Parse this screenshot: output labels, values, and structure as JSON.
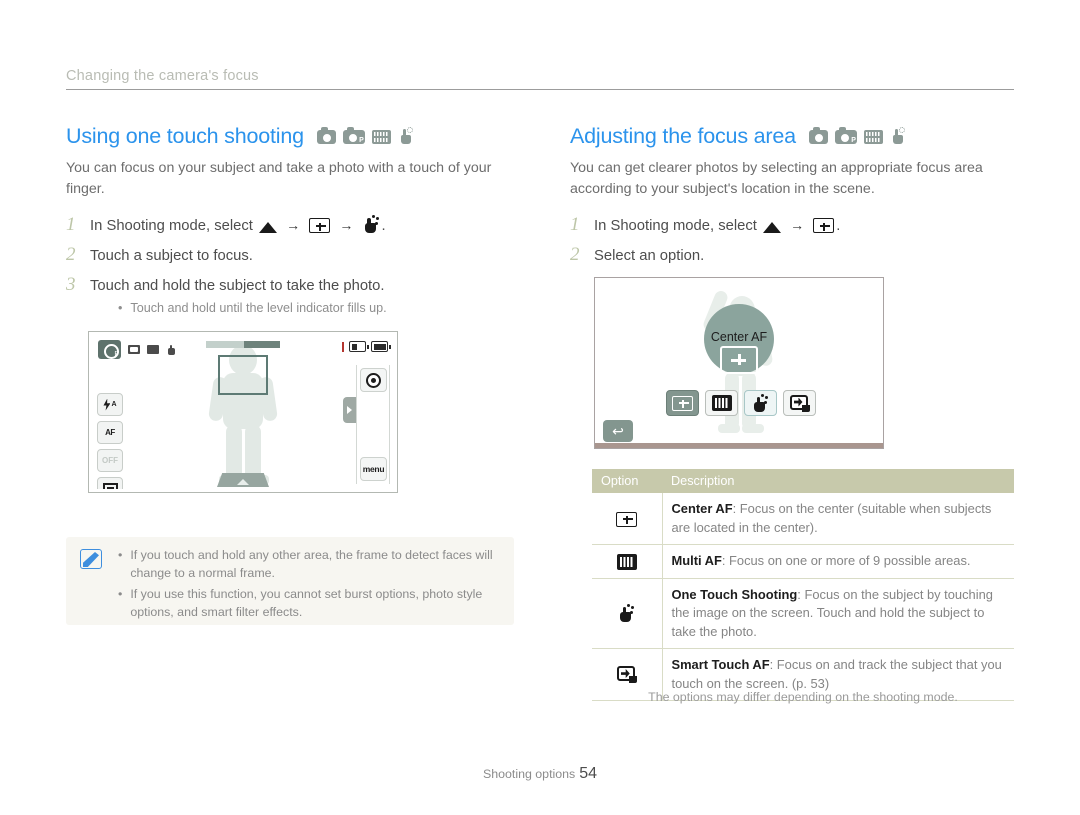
{
  "running_header": {
    "text": "Changing the camera's focus"
  },
  "left_column": {
    "heading": "Using one touch shooting",
    "mode_icons": [
      "camera-icon",
      "camera-program-icon",
      "scene-mode-icon",
      "one-touch-hand-icon"
    ],
    "intro": "You can focus on your subject and take a photo with a touch of your finger.",
    "steps": [
      {
        "num": "1",
        "text_before": "In Shooting mode, select",
        "icons": [
          "up-triangle-icon",
          "arrow-right",
          "center-af-box-icon",
          "arrow-right",
          "one-touch-hand-icon"
        ],
        "text_after": "."
      },
      {
        "num": "2",
        "text": "Touch a subject to focus."
      },
      {
        "num": "3",
        "text": "Touch and hold the subject to take the photo.",
        "substep": "Touch and hold until the level indicator fills up."
      }
    ],
    "camera_preview": {
      "mode_badge": "P",
      "status_icons": [
        "image-size-icon",
        "quality-icon",
        "hand-icon"
      ],
      "battery_icons": [
        "battery-half-icon",
        "battery-full-icon"
      ],
      "left_buttons": [
        "flash-auto",
        "af-mode",
        "timer-off",
        "display"
      ],
      "flash_label": "A",
      "af_label": "AF",
      "timer_label": "OFF",
      "right_buttons": [
        "lens-icon",
        "menu"
      ],
      "menu_label": "menu"
    },
    "note": {
      "icon": "note-pencil-icon",
      "items": [
        "If you touch and hold any other area, the frame to detect faces will change to a normal frame.",
        "If you use this function, you cannot set burst options, photo style options, and smart filter effects."
      ]
    }
  },
  "right_column": {
    "heading": "Adjusting the focus area",
    "mode_icons": [
      "camera-icon",
      "camera-program-icon",
      "scene-mode-icon",
      "one-touch-hand-icon"
    ],
    "intro": "You can get clearer photos by selecting an appropriate focus area according to your subject's location in the scene.",
    "steps": [
      {
        "num": "1",
        "text_before": "In Shooting mode, select",
        "icons": [
          "up-triangle-icon",
          "arrow-right",
          "center-af-box-icon"
        ],
        "text_after": "."
      },
      {
        "num": "2",
        "text": "Select an option."
      }
    ],
    "camera_preview": {
      "bubble_label": "Center AF",
      "option_buttons": [
        "center-af-icon",
        "multi-af-icon",
        "one-touch-shooting-icon",
        "smart-touch-af-icon"
      ],
      "back_button": "back-arrow-icon"
    },
    "table": {
      "headers": [
        "Option",
        "Description"
      ],
      "rows": [
        {
          "icon": "center-af-icon",
          "title": "Center AF",
          "desc": ": Focus on the center (suitable when subjects are located in the center)."
        },
        {
          "icon": "multi-af-icon",
          "title": "Multi AF",
          "desc": ": Focus on one or more of 9 possible areas."
        },
        {
          "icon": "one-touch-shooting-icon",
          "title": "One Touch Shooting",
          "desc": ": Focus on the subject by touching the image on the screen. Touch and hold the subject to take the photo."
        },
        {
          "icon": "smart-touch-af-icon",
          "title": "Smart Touch AF",
          "desc": ": Focus on and track the subject that you touch on the screen. (p. 53)"
        }
      ],
      "footnote": "The options may differ depending on the shooting mode."
    }
  },
  "footer": {
    "label": "Shooting options",
    "page": "54"
  },
  "colors": {
    "heading_blue": "#2b93ec",
    "step_number_green": "#bdc6a8",
    "table_header_bg": "#c7c9ab",
    "note_bg": "#f7f6f1",
    "note_icon_blue": "#3e8ede"
  }
}
